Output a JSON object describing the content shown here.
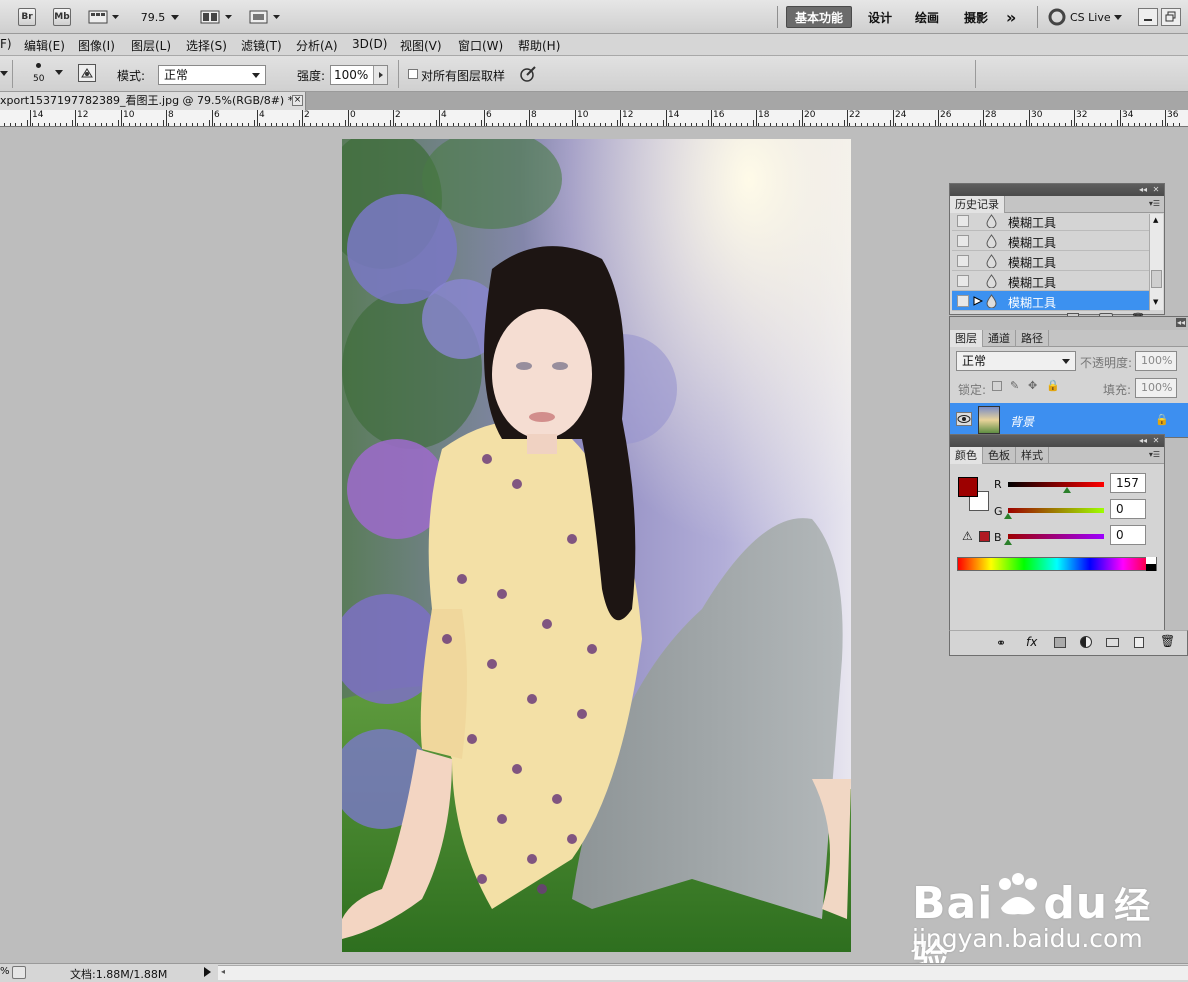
{
  "appbar": {
    "br_label": "Br",
    "mb_label": "Mb",
    "zoom_value": "79.5",
    "workspaces": [
      "基本功能",
      "设计",
      "绘画",
      "摄影"
    ],
    "more_label": "»",
    "cs_live_label": "CS Live"
  },
  "menu": [
    "F)",
    "编辑(E)",
    "图像(I)",
    "图层(L)",
    "选择(S)",
    "滤镜(T)",
    "分析(A)",
    "3D(D)",
    "视图(V)",
    "窗口(W)",
    "帮助(H)"
  ],
  "options": {
    "brush_size": "50",
    "mode_label": "模式:",
    "mode_value": "正常",
    "strength_label": "强度:",
    "strength_value": "100%",
    "sample_all_label": "对所有图层取样"
  },
  "document": {
    "tab_title": "xport1537197782389_看图王.jpg @ 79.5%(RGB/8#) *",
    "close_symbol": "×"
  },
  "ruler": {
    "labels": [
      "14",
      "12",
      "10",
      "8",
      "6",
      "4",
      "2",
      "0",
      "2",
      "4",
      "6",
      "8",
      "10",
      "12",
      "14",
      "16",
      "18",
      "20",
      "22",
      "24",
      "26",
      "28",
      "30",
      "32",
      "34",
      "36"
    ]
  },
  "history_panel": {
    "tab_label": "历史记录",
    "items": [
      "模糊工具",
      "模糊工具",
      "模糊工具",
      "模糊工具",
      "模糊工具"
    ],
    "selected_index": 4
  },
  "layers_panel": {
    "tabs": [
      "图层",
      "通道",
      "路径"
    ],
    "blend_mode": "正常",
    "opacity_label": "不透明度:",
    "opacity_value": "100%",
    "lock_label": "锁定:",
    "fill_label": "填充:",
    "fill_value": "100%",
    "layer_name": "背景"
  },
  "color_panel": {
    "tabs": [
      "颜色",
      "色板",
      "样式"
    ],
    "r_label": "R",
    "g_label": "G",
    "b_label": "B",
    "r_value": "157",
    "g_value": "0",
    "b_value": "0",
    "foreground_color": "#9d0000",
    "background_color": "#ffffff"
  },
  "status": {
    "doc_info": "文档:1.88M/1.88M"
  },
  "watermark": {
    "brand_left": "Bai",
    "brand_mid": "du",
    "brand_right": "经验",
    "url": "jingyan.baidu.com"
  }
}
